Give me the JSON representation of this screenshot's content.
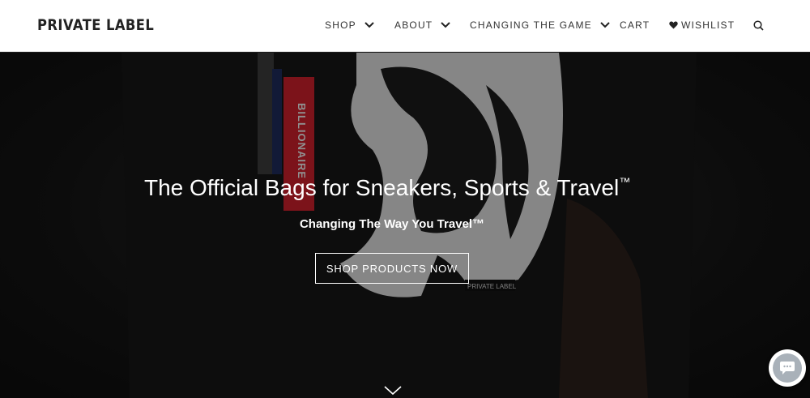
{
  "header": {
    "logo": "PRIVATE LABEL",
    "nav": {
      "shop": "SHOP",
      "about": "ABOUT",
      "changing_the_game": "CHANGING THE GAME",
      "cart": "CART",
      "wishlist": "WISHLIST"
    },
    "icons": {
      "shop_dropdown": "chevron-down-icon",
      "about_dropdown": "chevron-down-icon",
      "game_dropdown": "chevron-down-icon",
      "wishlist": "heart-icon",
      "search": "search-icon"
    }
  },
  "hero": {
    "background_tag_text": "BILLIONAIRE",
    "background_label_text": "PRIVATE LABEL",
    "title": "The Official Bags for Sneakers, Sports & Travel",
    "title_mark": "™",
    "subtitle": "Changing The Way You Travel™",
    "cta": "SHOP PRODUCTS NOW",
    "scroll_icon": "chevron-down-icon"
  },
  "chat": {
    "icon": "chat-bubble-icon"
  },
  "colors": {
    "header_bg": "#ffffff",
    "text_dark": "#222222",
    "hero_text": "#ffffff",
    "tag_red": "#c8202a",
    "tag_navy": "#1d2a5a",
    "chat_grey": "#a9b1b9"
  }
}
